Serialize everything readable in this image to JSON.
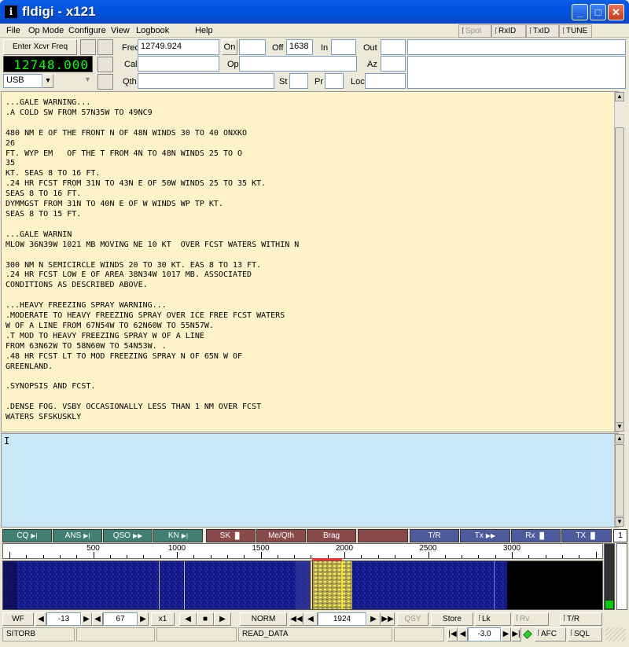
{
  "window": {
    "title": "fldigi - x121"
  },
  "menu": {
    "file": "File",
    "opmode": "Op Mode",
    "configure": "Configure",
    "view": "View",
    "logbook": "Logbook",
    "help": "Help"
  },
  "toggles": {
    "spot": "Spot",
    "rxid": "RxID",
    "txid": "TxID",
    "tune": "TUNE"
  },
  "xcvr": {
    "enter_label": "Enter Xcvr Freq",
    "freq_display": "12748.000",
    "mode": "USB"
  },
  "log": {
    "freq_label": "Freq",
    "freq_value": "12749.924",
    "on_label": "On",
    "on_value": "",
    "off_label": "Off",
    "off_value": "1638",
    "in_label": "In",
    "in_value": "",
    "out_label": "Out",
    "out_value": "",
    "call_label": "Call",
    "call_value": "",
    "op_label": "Op",
    "op_value": "",
    "az_label": "Az",
    "az_value": "",
    "qth_label": "Qth",
    "qth_value": "",
    "st_label": "St",
    "st_value": "",
    "pr_label": "Pr",
    "pr_value": "",
    "loc_label": "Loc",
    "loc_value": ""
  },
  "rx_text": "...GALE WARNING...\n.A COLD SW FROM 57N35W TO 49NC9\n\n480 NM E OF THE FRONT N OF 48N WINDS 30 TO 40 ONXKO\n26\nFT. WYP EM   OF THE T FROM 4N TO 48N WINDS 25 TO O\n35\nKT. SEAS 8 TO 16 FT.\n.24 HR FCST FROM 31N TO 43N E OF 50W WINDS 25 TO 35 KT.\nSEAS 8 TO 16 FT.\nDYMMGST FROM 31N TO 40N E OF W WINDS WP TP KT.\nSEAS 8 TO 15 FT.\n\n...GALE WARNIN\nMLOW 36N39W 1021 MB MOVING NE 10 KT  OVER FCST WATERS WITHIN N\n\n300 NM N SEMICIRCLE WINDS 20 TO 30 KT. EAS 8 TO 13 FT.\n.24 HR FCST LOW E OF AREA 38N34W 1017 MB. ASSOCIATED\nCONDITIONS AS DESCRIBED ABOVE.\n\n...HEAVY FREEZING SPRAY WARNING...\n.MODERATE TO HEAVY FREEZING SPRAY OVER ICE FREE FCST WATERS\nW OF A LINE FROM 67N54W TO 62N60W TO 55N57W.\n.T MOD TO HEAVY FREEZING SPRAY W OF A LINE\nFROM 63N62W TO 58N60W TO 54N53W. .\n.48 HR FCST LT TO MOD FREEZING SPRAY N OF 65N W OF\nGREENLAND.\n\n.SYNOPSIS AND FCST.\n\n.DENSE FOG. VSBY OCCASIONALLY LESS THAN 1 NM OVER FCST\nWATERS SFSKUSKLY",
  "macros": [
    {
      "label": "CQ",
      "glyph": "▶|",
      "color": "green"
    },
    {
      "label": "ANS",
      "glyph": "▶|",
      "color": "green"
    },
    {
      "label": "QSO",
      "glyph": "▶▶",
      "color": "green"
    },
    {
      "label": "KN",
      "glyph": "▶|",
      "color": "green"
    },
    {
      "label": "SK",
      "glyph": "▐▌",
      "color": "red"
    },
    {
      "label": "Me/Qth",
      "glyph": "",
      "color": "red"
    },
    {
      "label": "Brag",
      "glyph": "",
      "color": "red"
    },
    {
      "label": "",
      "glyph": "",
      "color": "red"
    },
    {
      "label": "T/R",
      "glyph": "",
      "color": "blue"
    },
    {
      "label": "Tx",
      "glyph": "▶▶",
      "color": "blue"
    },
    {
      "label": "Rx",
      "glyph": "▐▌",
      "color": "blue"
    },
    {
      "label": "TX",
      "glyph": "▐▌",
      "color": "blue"
    }
  ],
  "macro_set": "1",
  "scale": {
    "labels": [
      "500",
      "1000",
      "1500",
      "2000",
      "2500",
      "3000"
    ]
  },
  "controls": {
    "wf": "WF",
    "wf_level": "-13",
    "wf_range": "67",
    "zoom": "x1",
    "norm": "NORM",
    "carrier": "1924",
    "qsy": "QSY",
    "store": "Store",
    "lk": "Lk",
    "rv": "Rv",
    "tr": "T/R"
  },
  "statusbar": {
    "mode": "SITORB",
    "field2": "",
    "field3": "",
    "state": "READ_DATA",
    "field5": "",
    "squelch_value": "-3.0",
    "afc": "AFC",
    "sql": "SQL"
  }
}
